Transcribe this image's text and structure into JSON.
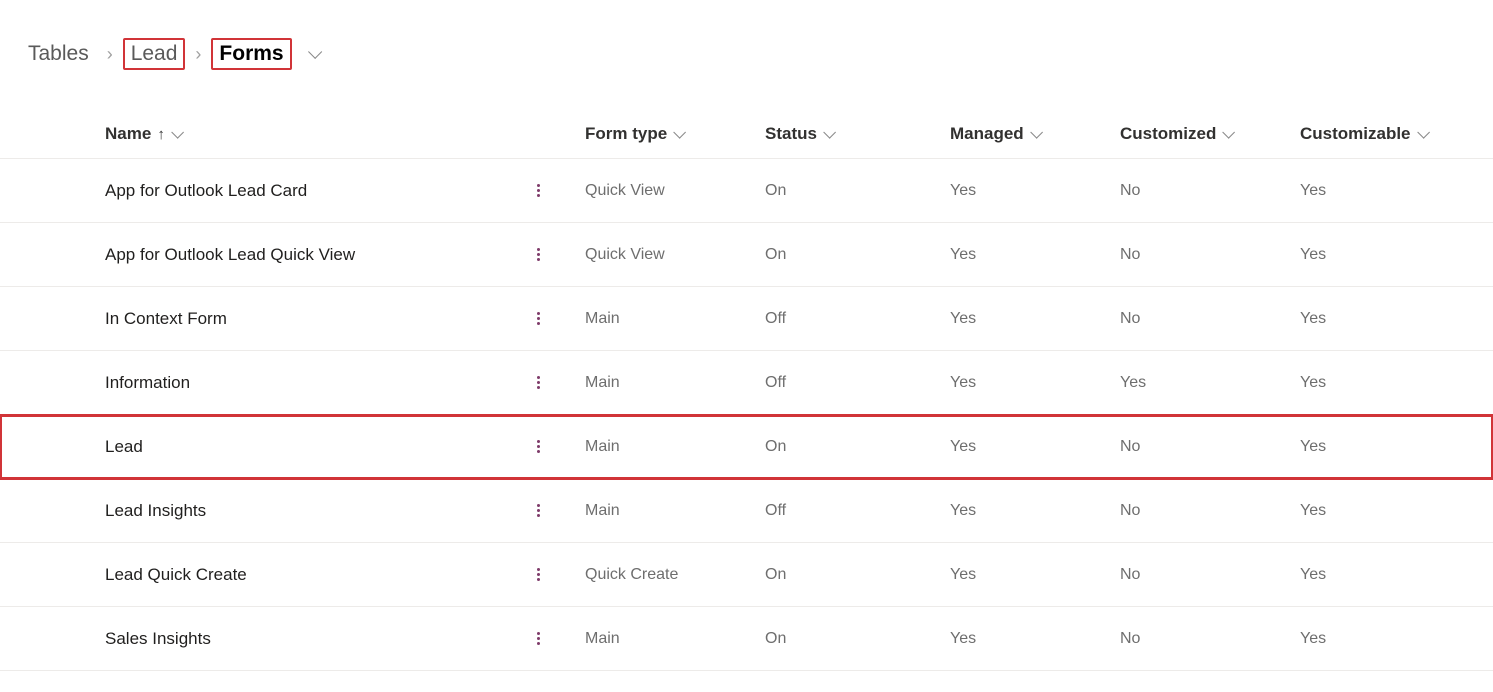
{
  "breadcrumb": {
    "root": "Tables",
    "entity": "Lead",
    "current": "Forms"
  },
  "columns": {
    "name": "Name",
    "form_type": "Form type",
    "status": "Status",
    "managed": "Managed",
    "customized": "Customized",
    "customizable": "Customizable"
  },
  "rows": [
    {
      "name": "App for Outlook Lead Card",
      "type": "Quick View",
      "status": "On",
      "managed": "Yes",
      "customized": "No",
      "customizable": "Yes",
      "highlight": false
    },
    {
      "name": "App for Outlook Lead Quick View",
      "type": "Quick View",
      "status": "On",
      "managed": "Yes",
      "customized": "No",
      "customizable": "Yes",
      "highlight": false
    },
    {
      "name": "In Context Form",
      "type": "Main",
      "status": "Off",
      "managed": "Yes",
      "customized": "No",
      "customizable": "Yes",
      "highlight": false
    },
    {
      "name": "Information",
      "type": "Main",
      "status": "Off",
      "managed": "Yes",
      "customized": "Yes",
      "customizable": "Yes",
      "highlight": false
    },
    {
      "name": "Lead",
      "type": "Main",
      "status": "On",
      "managed": "Yes",
      "customized": "No",
      "customizable": "Yes",
      "highlight": true
    },
    {
      "name": "Lead Insights",
      "type": "Main",
      "status": "Off",
      "managed": "Yes",
      "customized": "No",
      "customizable": "Yes",
      "highlight": false
    },
    {
      "name": "Lead Quick Create",
      "type": "Quick Create",
      "status": "On",
      "managed": "Yes",
      "customized": "No",
      "customizable": "Yes",
      "highlight": false
    },
    {
      "name": "Sales Insights",
      "type": "Main",
      "status": "On",
      "managed": "Yes",
      "customized": "No",
      "customizable": "Yes",
      "highlight": false
    }
  ]
}
